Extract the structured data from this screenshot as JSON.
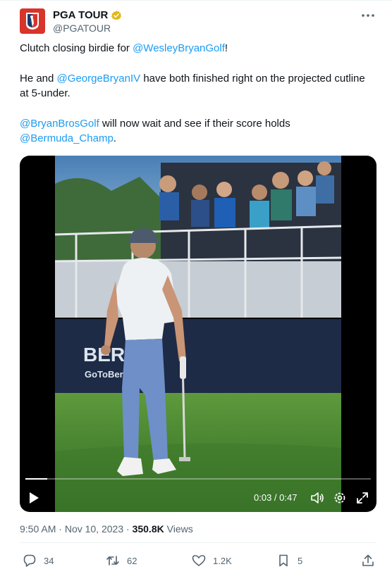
{
  "author": {
    "display_name": "PGA TOUR",
    "handle": "@PGATOUR",
    "verified_badge_color": "#e2b719"
  },
  "tweet": {
    "line1_text": "Clutch closing birdie for ",
    "line1_mention": "@WesleyBryanGolf",
    "line1_end": "!",
    "line2_start": "He and ",
    "line2_mention": "@GeorgeBryanIV",
    "line2_text": " have both finished right on the projected cutline at 5-under.",
    "line3_mention": "@BryanBrosGolf",
    "line3_text": " will now wait and see if their score holds ",
    "line3_mention2": "@Bermuda_Champ",
    "line3_end": "."
  },
  "video": {
    "current_time": "0:03",
    "separator": " / ",
    "duration": "0:47",
    "progress_fraction": 0.064,
    "controls": [
      "play-icon",
      "volume-icon",
      "settings-icon",
      "fullscreen-icon"
    ],
    "banner_text_1": "BERM",
    "banner_text_2": "GoToBermuda"
  },
  "meta": {
    "time": "9:50 AM",
    "dot": " · ",
    "date": "Nov 10, 2023",
    "views_count": "350.8K",
    "views_label": " Views"
  },
  "actions": {
    "replies": "34",
    "retweets": "62",
    "likes": "1.2K",
    "bookmarks": "5"
  },
  "colors": {
    "link": "#1d9bf0",
    "secondary_text": "#536471",
    "brand_red": "#d8342a",
    "brand_blue": "#1c3a6b"
  }
}
